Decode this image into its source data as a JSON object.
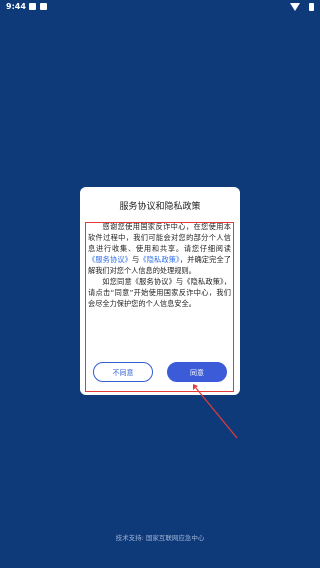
{
  "status_bar": {
    "time": "9:44",
    "notification_icons": [
      "image-icon",
      "box-icon"
    ],
    "right_icons": [
      "wifi-icon",
      "battery-icon"
    ]
  },
  "dialog": {
    "title": "服务协议和隐私政策",
    "para1_a": "感谢您使用国家反诈中心，在您使用本软件过程中，我们可能会对您的部分个人信息进行收集、使用和共享。请您仔细阅读",
    "service_link": "《服务协议》",
    "para1_b": "与",
    "privacy_link": "《隐私政策》",
    "para1_c": "，并确定完全了解我们对您个人信息的处理规则。",
    "para2": "如您同意《服务协议》与《隐私政策》，请点击“同意”开始使用国家反诈中心，我们会尽全力保护您的个人信息安全。",
    "disagree_label": "不同意",
    "agree_label": "同意"
  },
  "footer": {
    "text": "技术支持: 国家互联网应急中心"
  },
  "colors": {
    "background": "#0f3a7a",
    "link": "#2f6fe8",
    "agree_button": "#3b5bd9",
    "annotation_red": "#e23b3b"
  }
}
